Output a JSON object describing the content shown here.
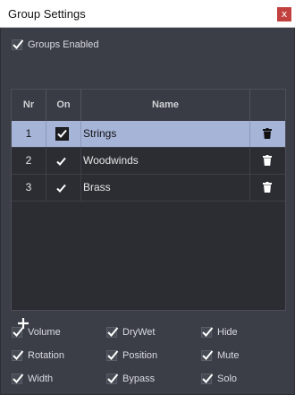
{
  "window": {
    "title": "Group Settings",
    "close_glyph": "x"
  },
  "groups_enabled": {
    "label": "Groups Enabled",
    "checked": true
  },
  "table": {
    "headers": {
      "nr": "Nr",
      "on": "On",
      "name": "Name"
    },
    "rows": [
      {
        "nr": "1",
        "on": true,
        "name": "Strings",
        "selected": true
      },
      {
        "nr": "2",
        "on": true,
        "name": "Woodwinds",
        "selected": false
      },
      {
        "nr": "3",
        "on": true,
        "name": "Brass",
        "selected": false
      }
    ]
  },
  "add_button_icon": "plus-icon",
  "row_delete_icon": "trash-icon",
  "options": [
    {
      "label": "Volume",
      "checked": true
    },
    {
      "label": "DryWet",
      "checked": true
    },
    {
      "label": "Hide",
      "checked": true
    },
    {
      "label": "Rotation",
      "checked": true
    },
    {
      "label": "Position",
      "checked": true
    },
    {
      "label": "Mute",
      "checked": true
    },
    {
      "label": "Width",
      "checked": true
    },
    {
      "label": "Bypass",
      "checked": true
    },
    {
      "label": "Solo",
      "checked": true
    }
  ],
  "colors": {
    "background": "#3b3e46",
    "selected_row": "#a6b4d8",
    "close_button": "#c1413e",
    "table_bg": "#2b2d33"
  }
}
